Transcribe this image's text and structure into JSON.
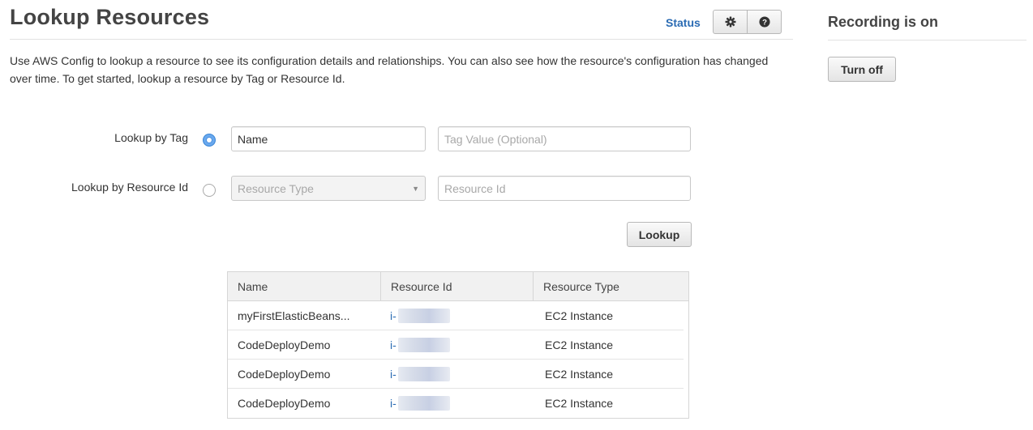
{
  "header": {
    "title": "Lookup Resources",
    "status_link": "Status",
    "settings_icon": "gear-icon",
    "help_icon": "question-icon"
  },
  "intro": "Use AWS Config to lookup a resource to see its configuration details and relationships. You can also see how the resource's configuration has changed over time. To get started, lookup a resource by Tag or Resource Id.",
  "form": {
    "by_tag": {
      "label": "Lookup by Tag",
      "selected": true,
      "tag_key_value": "Name",
      "tag_value_placeholder": "Tag Value (Optional)"
    },
    "by_resource_id": {
      "label": "Lookup by Resource Id",
      "selected": false,
      "resource_type_placeholder": "Resource Type",
      "resource_id_placeholder": "Resource Id"
    },
    "lookup_button": "Lookup"
  },
  "results": {
    "columns": [
      "Name",
      "Resource Id",
      "Resource Type"
    ],
    "rows": [
      {
        "name": "myFirstElasticBeans...",
        "resource_id": "i-",
        "resource_type": "EC2 Instance"
      },
      {
        "name": "CodeDeployDemo",
        "resource_id": "i-",
        "resource_type": "EC2 Instance"
      },
      {
        "name": "CodeDeployDemo",
        "resource_id": "i-",
        "resource_type": "EC2 Instance"
      },
      {
        "name": "CodeDeployDemo",
        "resource_id": "i-",
        "resource_type": "EC2 Instance"
      }
    ]
  },
  "recording": {
    "title": "Recording is on",
    "button": "Turn off"
  },
  "colors": {
    "link": "#2a6bb3",
    "radio_selected": "#4a90e2",
    "title": "#444444"
  }
}
